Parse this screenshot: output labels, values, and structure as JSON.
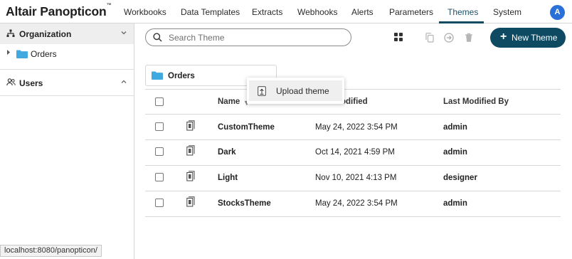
{
  "app": {
    "logo": "Altair Panopticon",
    "tm": "™",
    "avatar": "A"
  },
  "nav": {
    "workbooks": "Workbooks",
    "data_templates": "Data Templates",
    "extracts": "Extracts",
    "webhooks": "Webhooks",
    "alerts": "Alerts",
    "parameters": "Parameters",
    "themes": "Themes",
    "system": "System",
    "active": "Themes"
  },
  "sidebar": {
    "organization": "Organization",
    "folder": "Orders",
    "users": "Users"
  },
  "toolbar": {
    "search_placeholder": "Search Theme",
    "new_button": "New Theme"
  },
  "folder": {
    "name": "Orders"
  },
  "popup": {
    "upload": "Upload theme"
  },
  "table": {
    "headers": {
      "name": "Name",
      "last_modified": "Last Modified",
      "last_modified_visible": "odified",
      "last_modified_by": "Last Modified By"
    },
    "rows": [
      {
        "name": "CustomTheme",
        "modified": "May 24, 2022 3:54 PM",
        "by": "admin"
      },
      {
        "name": "Dark",
        "modified": "Oct 14, 2021 4:59 PM",
        "by": "admin"
      },
      {
        "name": "Light",
        "modified": "Nov 10, 2021 4:13 PM",
        "by": "designer"
      },
      {
        "name": "StocksTheme",
        "modified": "May 24, 2022 3:54 PM",
        "by": "admin"
      }
    ]
  },
  "status_bar": {
    "url": "localhost:8080/panopticon/"
  },
  "colors": {
    "accent": "#0e4b63",
    "folder": "#3fa9e0",
    "avatar": "#2b6fd8"
  }
}
